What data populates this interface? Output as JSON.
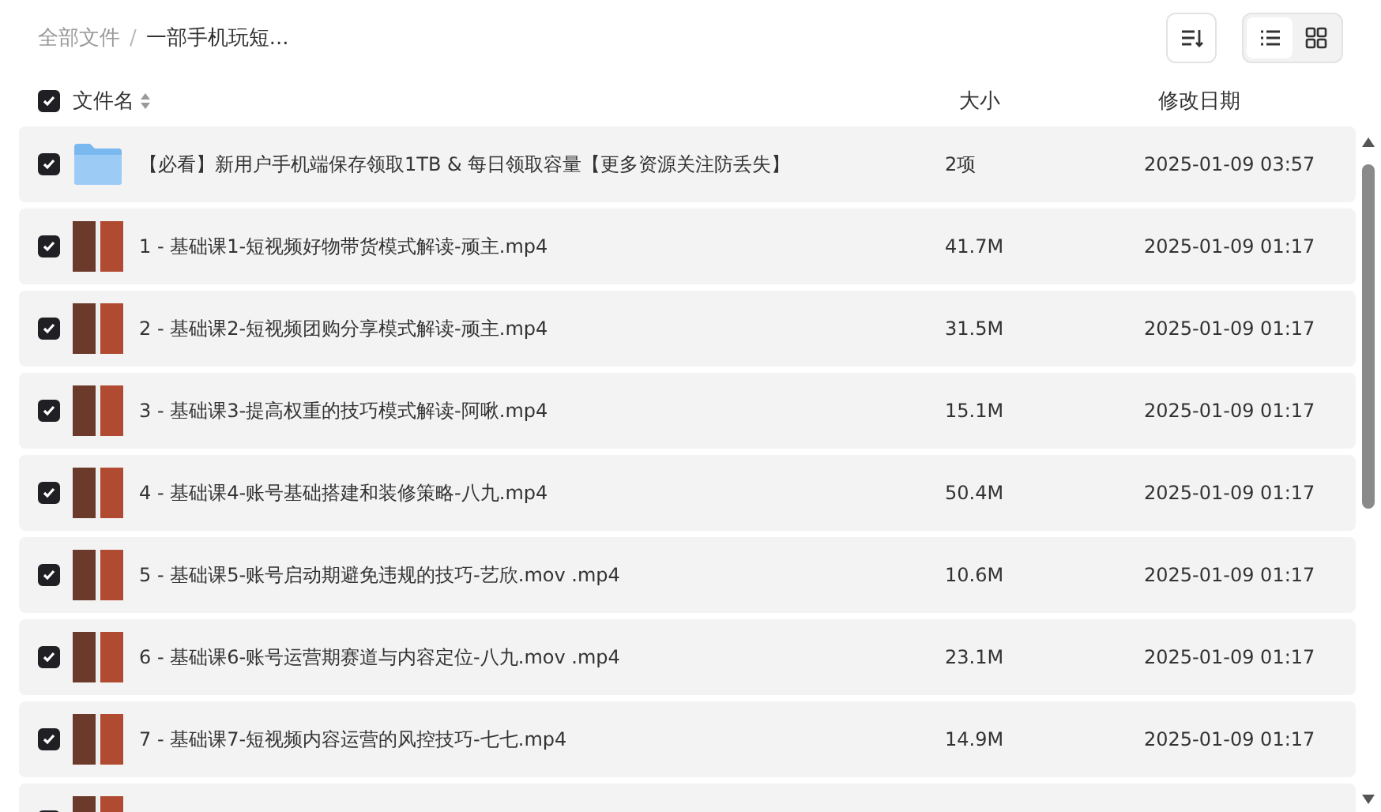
{
  "breadcrumb": [
    {
      "label": "全部文件",
      "current": false
    },
    {
      "label": "一部手机玩短...",
      "current": true
    }
  ],
  "breadcrumb_separator": "/",
  "view_modes": [
    {
      "kind": "list",
      "selected": true
    },
    {
      "kind": "grid",
      "selected": false
    }
  ],
  "header": {
    "checked": true,
    "name": "文件名",
    "size": "大小",
    "date": "修改日期"
  },
  "files": [
    {
      "kind": "folder",
      "checked": true,
      "name": "【必看】新用户手机端保存领取1TB & 每日领取容量【更多资源关注防丢失】",
      "size": "2项",
      "date": "2025-01-09 03:57"
    },
    {
      "kind": "video",
      "checked": true,
      "name": "1 - 基础课1-短视频好物带货模式解读-顽主.mp4",
      "size": "41.7M",
      "date": "2025-01-09 01:17"
    },
    {
      "kind": "video",
      "checked": true,
      "name": "2 - 基础课2-短视频团购分享模式解读-顽主.mp4",
      "size": "31.5M",
      "date": "2025-01-09 01:17"
    },
    {
      "kind": "video",
      "checked": true,
      "name": "3 - 基础课3-提高权重的技巧模式解读-阿啾.mp4",
      "size": "15.1M",
      "date": "2025-01-09 01:17"
    },
    {
      "kind": "video",
      "checked": true,
      "name": "4 - 基础课4-账号基础搭建和装修策略-八九.mp4",
      "size": "50.4M",
      "date": "2025-01-09 01:17"
    },
    {
      "kind": "video",
      "checked": true,
      "name": "5 - 基础课5-账号启动期避免违规的技巧-艺欣.mov .mp4",
      "size": "10.6M",
      "date": "2025-01-09 01:17"
    },
    {
      "kind": "video",
      "checked": true,
      "name": "6 - 基础课6-账号运营期赛道与内容定位-八九.mov .mp4",
      "size": "23.1M",
      "date": "2025-01-09 01:17"
    },
    {
      "kind": "video",
      "checked": true,
      "name": "7 - 基础课7-短视频内容运营的风控技巧-七七.mp4",
      "size": "14.9M",
      "date": "2025-01-09 01:17"
    },
    {
      "kind": "video",
      "checked": true
    }
  ]
}
